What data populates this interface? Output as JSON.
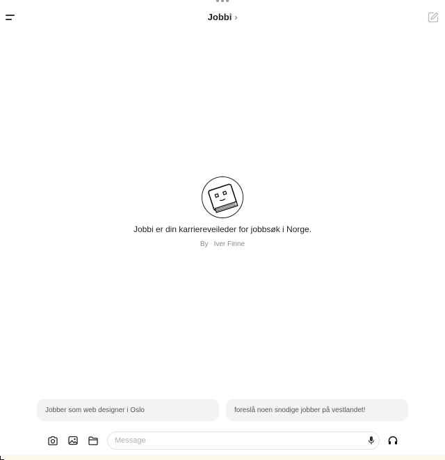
{
  "header": {
    "title": "Jobbi",
    "chevron": "›"
  },
  "gpt": {
    "description": "Jobbi er din karriereveileder for jobbsøk i Norge.",
    "by_label": "By",
    "author": "Iver Finne"
  },
  "suggestions": [
    {
      "label": "Jobber som web designer i Oslo"
    },
    {
      "label": "foreslå noen snodige jobber på vestlandet!"
    }
  ],
  "composer": {
    "placeholder": "Message"
  },
  "icons": {
    "menu": "sidebar-menu-icon",
    "edit": "new-chat-icon",
    "camera": "camera-icon",
    "photo": "photo-library-icon",
    "folder": "folder-icon",
    "mic": "microphone-icon",
    "voice": "headphones-icon"
  },
  "colors": {
    "background": "#ffffff",
    "suggestion_bg": "#f3f3f3",
    "muted_text": "#8a8a8a"
  }
}
